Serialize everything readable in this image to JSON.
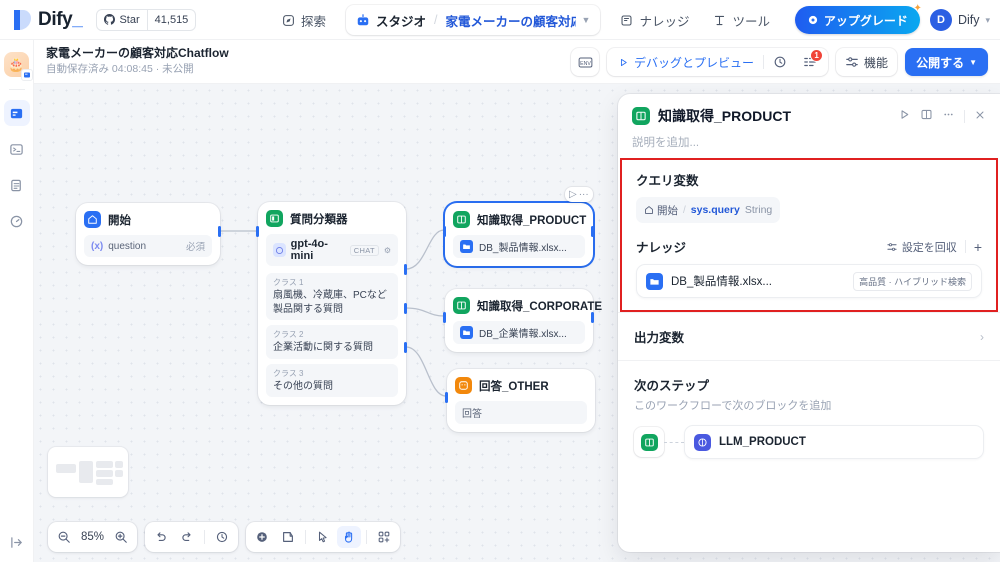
{
  "header": {
    "brand": "Dify",
    "brand_cursor": "_",
    "star_label": "Star",
    "star_count": "41,515",
    "nav": {
      "explore": "探索",
      "studio": "スタジオ",
      "separator": "/",
      "app_name": "家電メーカーの顧客対応C...",
      "knowledge": "ナレッジ",
      "tools": "ツール"
    },
    "upgrade": "アップグレード",
    "avatar_letter": "D",
    "user_name": "Dify"
  },
  "subbar": {
    "title": "家電メーカーの顧客対応Chatflow",
    "status": "自動保存済み 04:08:45 · 未公開",
    "env_label": "ENV",
    "debug_preview": "デバッグとプレビュー",
    "features": "機能",
    "publish": "公開する",
    "notification_count": "1"
  },
  "sidebar": {
    "items": [
      {
        "name": "app-icon",
        "glyph": "🎂"
      },
      {
        "name": "workflow-icon",
        "glyph": "▤"
      },
      {
        "name": "terminal-icon",
        "glyph": "▣"
      },
      {
        "name": "logs-icon",
        "glyph": "▥"
      },
      {
        "name": "monitor-icon",
        "glyph": "◉"
      }
    ],
    "collapse_glyph": "→|"
  },
  "canvas": {
    "zoom_level": "85%",
    "nodes": [
      {
        "id": "start",
        "title": "開始",
        "icon": "home-icon",
        "field_label": "question",
        "field_prefix": "(x)",
        "field_required": "必須"
      },
      {
        "id": "classifier",
        "title": "質問分類器",
        "icon": "classifier-icon",
        "model": "gpt-4o-mini",
        "model_tag": "CHAT",
        "classes": [
          {
            "label": "クラス 1",
            "text": "扇風機、冷蔵庫、PCなど製品関する質問"
          },
          {
            "label": "クラス 2",
            "text": "企業活動に関する質問"
          },
          {
            "label": "クラス 3",
            "text": "その他の質問"
          }
        ]
      },
      {
        "id": "knowledge-product",
        "title": "知識取得_PRODUCT",
        "icon": "knowledge-icon",
        "dataset": "DB_製品情報.xlsx..."
      },
      {
        "id": "knowledge-corporate",
        "title": "知識取得_CORPORATE",
        "icon": "knowledge-icon",
        "dataset": "DB_企業情報.xlsx..."
      },
      {
        "id": "answer-other",
        "title": "回答_OTHER",
        "icon": "answer-icon",
        "field_label": "回答"
      }
    ]
  },
  "panel": {
    "icon": "knowledge-icon",
    "title": "知識取得_PRODUCT",
    "description_placeholder": "説明を追加...",
    "actions": {
      "run": "run-icon",
      "help": "book-icon",
      "more": "more-icon",
      "close": "close-icon"
    },
    "query_variable": {
      "section_title": "クエリ変数",
      "node_name": "開始",
      "var_key": "sys.query",
      "var_type": "String"
    },
    "knowledge": {
      "section_title": "ナレッジ",
      "recall_settings": "設定を回収",
      "add": "+",
      "items": [
        {
          "name": "DB_製品情報.xlsx...",
          "tag": "高品質 · ハイブリッド検索"
        }
      ]
    },
    "output": {
      "section_title": "出力変数"
    },
    "next_step": {
      "title": "次のステップ",
      "subtitle": "このワークフローで次のブロックを追加",
      "card_label": "LLM_PRODUCT"
    }
  },
  "controls": {
    "zoom_out": "zoom-out-icon",
    "zoom_value": "85%",
    "zoom_in": "zoom-in-icon",
    "undo": "undo-icon",
    "redo": "redo-icon",
    "history": "history-icon",
    "add_node": "add-node-icon",
    "add_note": "add-note-icon",
    "pointer": "pointer-icon",
    "hand": "hand-icon",
    "organize": "organize-icon"
  },
  "colors": {
    "accent": "#2a6ff3",
    "green": "#11a55f",
    "orange": "#f2880c",
    "highlight_border": "#e02020"
  }
}
